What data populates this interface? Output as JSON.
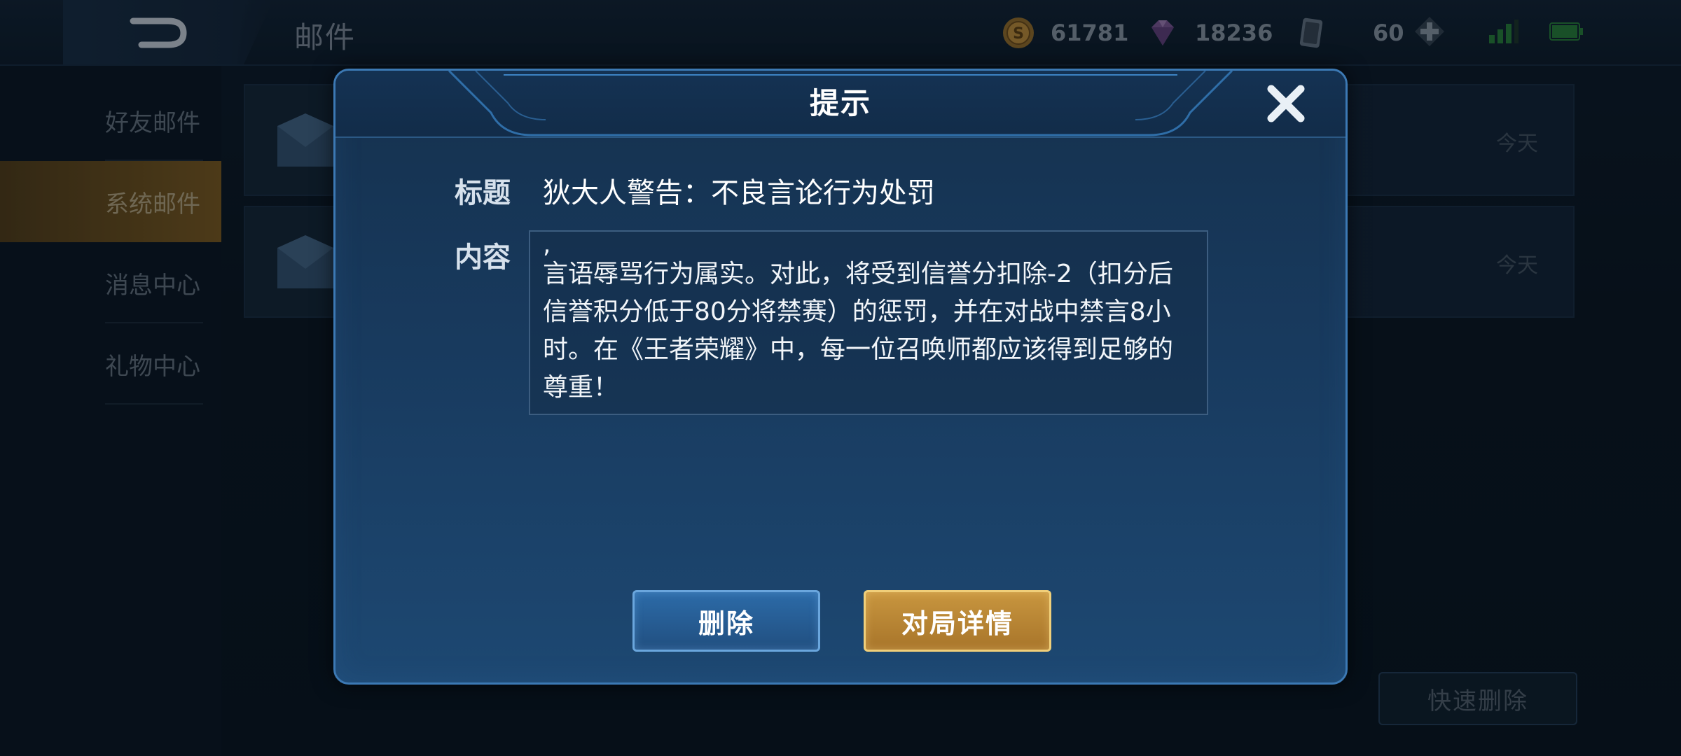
{
  "header": {
    "title": "邮件",
    "coins": "61781",
    "gems": "18236",
    "cards": "60"
  },
  "sidebar": {
    "items": [
      {
        "label": "好友邮件"
      },
      {
        "label": "系统邮件",
        "active": true
      },
      {
        "label": "消息中心"
      },
      {
        "label": "礼物中心"
      }
    ]
  },
  "mail_list": {
    "items": [
      {
        "date": "今天"
      },
      {
        "date": "今天"
      }
    ],
    "quick_delete_label": "快速删除"
  },
  "dialog": {
    "title": "提示",
    "subject_label": "标题",
    "subject": "狄大人警告：不良言论行为处罚",
    "content_label": "内容",
    "content_lead": ",",
    "content": "言语辱骂行为属实。对此，将受到信誉分扣除-2（扣分后信誉积分低于80分将禁赛）的惩罚，并在对战中禁言8小时。在《王者荣耀》中，每一位召唤师都应该得到足够的尊重！",
    "delete_label": "删除",
    "details_label": "对局详情"
  },
  "icons": {
    "back": "back-arrow-icon",
    "coin": "gold-coin-icon",
    "gem": "gem-icon",
    "card": "card-icon",
    "plus": "plus-icon",
    "signal": "signal-icon",
    "battery": "battery-icon",
    "mail": "envelope-icon",
    "close": "close-icon"
  },
  "colors": {
    "accent_gold": "#c8963f",
    "accent_blue": "#2c6ba8",
    "dialog_border": "#3c79b4"
  }
}
